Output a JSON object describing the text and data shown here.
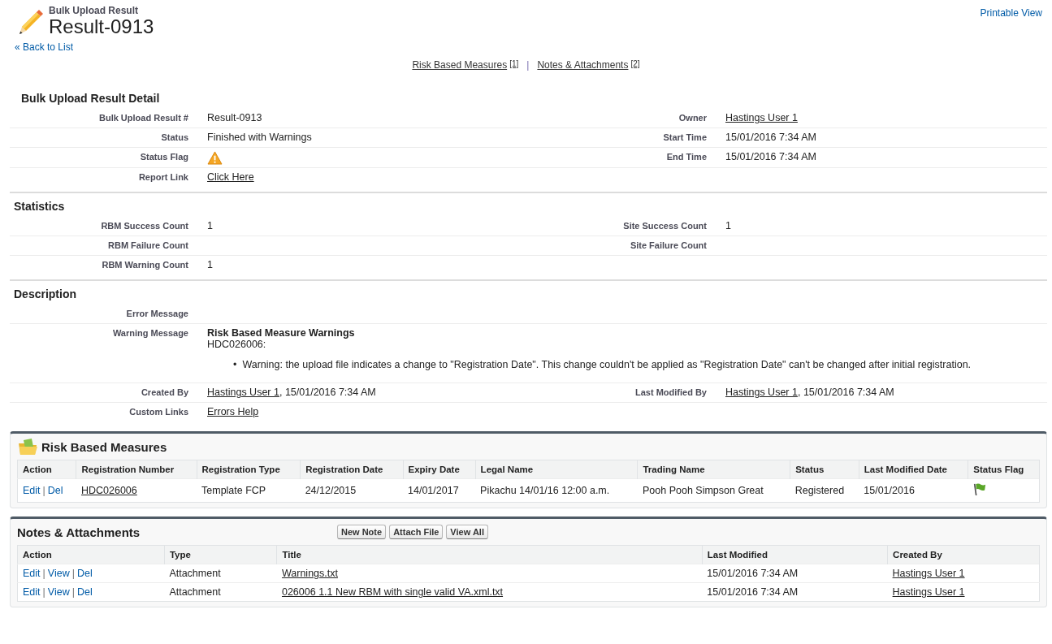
{
  "header": {
    "kicker": "Bulk Upload Result",
    "title": "Result-0913",
    "back_link": "« Back to List",
    "printable_link": "Printable View"
  },
  "related_nav": {
    "separator": "|",
    "links": [
      {
        "label": "Risk Based Measures",
        "count": "[1]"
      },
      {
        "label": "Notes & Attachments",
        "count": "[2]"
      }
    ]
  },
  "sections": [
    {
      "kind": "main",
      "title": "Bulk Upload Result Detail",
      "rows": [
        {
          "kind": "pair",
          "left": {
            "label": "Bulk Upload Result #",
            "value": [
              {
                "kind": "text",
                "text": "Result-0913"
              }
            ]
          },
          "right": {
            "label": "Owner",
            "value": [
              {
                "kind": "link",
                "text": "Hastings User 1"
              }
            ]
          }
        },
        {
          "kind": "pair",
          "left": {
            "label": "Status",
            "value": [
              {
                "kind": "text",
                "text": "Finished with Warnings"
              }
            ]
          },
          "right": {
            "label": "Start Time",
            "value": [
              {
                "kind": "text",
                "text": "15/01/2016 7:34 AM"
              }
            ]
          }
        },
        {
          "kind": "pair",
          "left": {
            "label": "Status Flag",
            "value": [
              {
                "kind": "warning"
              }
            ]
          },
          "right": {
            "label": "End Time",
            "value": [
              {
                "kind": "text",
                "text": "15/01/2016 7:34 AM"
              }
            ]
          }
        },
        {
          "kind": "pair",
          "left": {
            "label": "Report Link",
            "value": [
              {
                "kind": "link",
                "text": "Click Here"
              }
            ]
          }
        }
      ]
    },
    {
      "kind": "sub",
      "title": "Statistics",
      "rows": [
        {
          "kind": "pair",
          "left": {
            "label": "RBM Success Count",
            "value": [
              {
                "kind": "text",
                "text": "1"
              }
            ]
          },
          "right": {
            "label": "Site Success Count",
            "value": [
              {
                "kind": "text",
                "text": "1"
              }
            ]
          }
        },
        {
          "kind": "pair",
          "left": {
            "label": "RBM Failure Count"
          },
          "right": {
            "label": "Site Failure Count"
          }
        },
        {
          "kind": "pair",
          "left": {
            "label": "RBM Warning Count",
            "value": [
              {
                "kind": "text",
                "text": "1"
              }
            ]
          }
        }
      ]
    },
    {
      "kind": "sub",
      "title": "Description",
      "rows": [
        {
          "kind": "pair",
          "left": {
            "label": "Error Message"
          }
        },
        {
          "kind": "wide",
          "label": "Warning Message",
          "heading": "Risk Based Measure Warnings",
          "subheading": "HDC026006:",
          "bullet": "•",
          "bullets": [
            "Warning: the upload file indicates a change to \"Registration Date\". This change couldn't be applied as \"Registration Date\" can't be changed after initial registration."
          ]
        },
        {
          "kind": "pair",
          "left": {
            "label": "Created By",
            "value": [
              {
                "kind": "link",
                "text": "Hastings User 1"
              },
              {
                "kind": "text",
                "text": ", 15/01/2016 7:34 AM"
              }
            ]
          },
          "right": {
            "label": "Last Modified By",
            "value": [
              {
                "kind": "link",
                "text": "Hastings User 1"
              },
              {
                "kind": "text",
                "text": ", 15/01/2016 7:34 AM"
              }
            ]
          }
        },
        {
          "kind": "pair",
          "left": {
            "label": "Custom Links",
            "value": [
              {
                "kind": "link",
                "text": "Errors Help"
              }
            ]
          }
        }
      ]
    }
  ],
  "related_lists": [
    {
      "kind": "iconic",
      "title": "Risk Based Measures",
      "separator": "|",
      "columns": [
        "Action",
        "Registration Number",
        "Registration Type",
        "Registration Date",
        "Expiry Date",
        "Legal Name",
        "Trading Name",
        "Status",
        "Last Modified Date",
        "Status Flag"
      ],
      "rows": [
        [
          {
            "kind": "actions",
            "links": [
              "Edit",
              "Del"
            ]
          },
          {
            "kind": "link",
            "text": "HDC026006"
          },
          {
            "kind": "text",
            "text": "Template FCP"
          },
          {
            "kind": "text",
            "text": "24/12/2015"
          },
          {
            "kind": "text",
            "text": "14/01/2017"
          },
          {
            "kind": "text",
            "text": "Pikachu 14/01/16 12:00 a.m."
          },
          {
            "kind": "text",
            "text": "Pooh Pooh Simpson Great"
          },
          {
            "kind": "text",
            "text": "Registered"
          },
          {
            "kind": "text",
            "text": "15/01/2016"
          },
          {
            "kind": "flag"
          }
        ]
      ]
    },
    {
      "kind": "plain",
      "title": "Notes & Attachments",
      "buttons": [
        "New Note",
        "Attach File",
        "View All"
      ],
      "separator": "|",
      "columns": [
        "Action",
        "Type",
        "Title",
        "Last Modified",
        "Created By"
      ],
      "rows": [
        [
          {
            "kind": "actions",
            "links": [
              "Edit",
              "View",
              "Del"
            ]
          },
          {
            "kind": "text",
            "text": "Attachment"
          },
          {
            "kind": "link",
            "text": "Warnings.txt"
          },
          {
            "kind": "text",
            "text": "15/01/2016 7:34 AM"
          },
          {
            "kind": "link",
            "text": "Hastings User 1"
          }
        ],
        [
          {
            "kind": "actions",
            "links": [
              "Edit",
              "View",
              "Del"
            ]
          },
          {
            "kind": "text",
            "text": "Attachment"
          },
          {
            "kind": "link",
            "text": "026006 1.1 New RBM with single valid VA.xml.txt"
          },
          {
            "kind": "text",
            "text": "15/01/2016 7:34 AM"
          },
          {
            "kind": "link",
            "text": "Hastings User 1"
          }
        ]
      ]
    }
  ]
}
